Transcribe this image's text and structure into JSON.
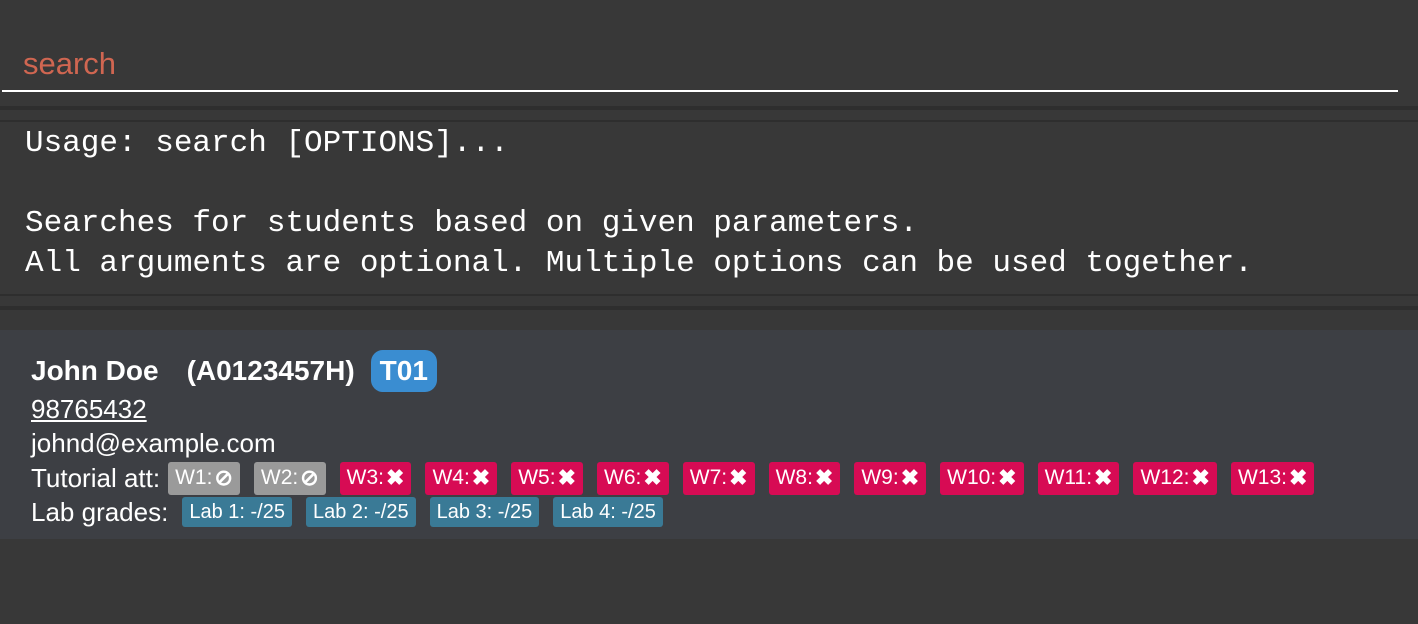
{
  "command_box": {
    "value": "search"
  },
  "result_display": {
    "lines": [
      "Usage: search [OPTIONS]...",
      "",
      "Searches for students based on given parameters.",
      "All arguments are optional. Multiple options can be used together."
    ]
  },
  "person": {
    "name": "John Doe",
    "student_id": "(A0123457H)",
    "tutorial": "T01",
    "phone": "98765432",
    "email": "johnd@example.com",
    "attendance_label": "Tutorial att:",
    "attendance": [
      {
        "week": "W1:",
        "status": "not-applicable",
        "symbol": "⊘"
      },
      {
        "week": "W2:",
        "status": "not-applicable",
        "symbol": "⊘"
      },
      {
        "week": "W3:",
        "status": "absent",
        "symbol": "✖"
      },
      {
        "week": "W4:",
        "status": "absent",
        "symbol": "✖"
      },
      {
        "week": "W5:",
        "status": "absent",
        "symbol": "✖"
      },
      {
        "week": "W6:",
        "status": "absent",
        "symbol": "✖"
      },
      {
        "week": "W7:",
        "status": "absent",
        "symbol": "✖"
      },
      {
        "week": "W8:",
        "status": "absent",
        "symbol": "✖"
      },
      {
        "week": "W9:",
        "status": "absent",
        "symbol": "✖"
      },
      {
        "week": "W10:",
        "status": "absent",
        "symbol": "✖"
      },
      {
        "week": "W11:",
        "status": "absent",
        "symbol": "✖"
      },
      {
        "week": "W12:",
        "status": "absent",
        "symbol": "✖"
      },
      {
        "week": "W13:",
        "status": "absent",
        "symbol": "✖"
      }
    ],
    "lab_label": "Lab grades:",
    "lab_grades": [
      "Lab 1: -/25",
      "Lab 2: -/25",
      "Lab 3: -/25",
      "Lab 4: -/25"
    ]
  },
  "colors": {
    "command_text": "#d06651",
    "tutorial_badge": "#3a8dd1",
    "absent_chip": "#d70b54",
    "na_chip": "#9a9a9a",
    "lab_chip": "#3a7a96"
  }
}
